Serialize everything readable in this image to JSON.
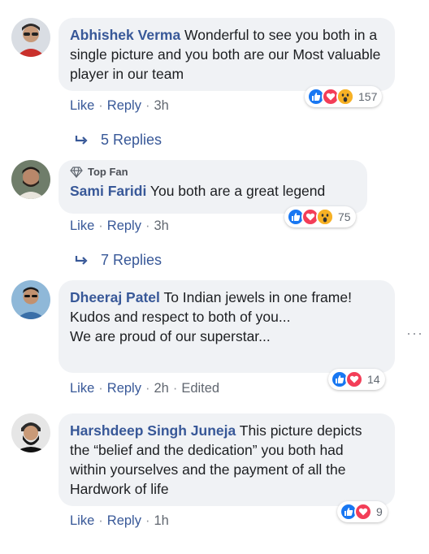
{
  "comments": [
    {
      "author": "Abhishek Verma",
      "text": "Wonderful to see you both in a single picture and you both are our Most valuable player in our team",
      "like": "Like",
      "reply": "Reply",
      "time": "3h",
      "reaction_count": "157",
      "replies_label": "5 Replies"
    },
    {
      "badge": "Top Fan",
      "author": "Sami Faridi",
      "text": "You both are a great legend",
      "like": "Like",
      "reply": "Reply",
      "time": "3h",
      "reaction_count": "75",
      "replies_label": "7 Replies"
    },
    {
      "author": "Dheeraj Patel",
      "text_lines": [
        "To Indian jewels in one frame!",
        "Kudos and respect to both of you...",
        "We are proud of our superstar..."
      ],
      "like": "Like",
      "reply": "Reply",
      "time": "2h",
      "edited": "Edited",
      "reaction_count": "14"
    },
    {
      "author": "Harshdeep Singh Juneja",
      "text": "This picture depicts the “belief and the dedication” you both had within yourselves and the payment of all the Hardwork of life",
      "like": "Like",
      "reply": "Reply",
      "time": "1h",
      "reaction_count": "9"
    }
  ],
  "icons": {
    "like": "like-reaction-icon",
    "love": "love-reaction-icon",
    "wow": "wow-reaction-icon",
    "reply_arrow": "reply-arrow-icon",
    "diamond": "top-fan-diamond-icon",
    "more": "more-options-icon"
  },
  "colors": {
    "author": "#385898",
    "bubble": "#f0f2f5",
    "like": "#1877f2",
    "love": "#f33e58",
    "wow": "#f7b125"
  }
}
